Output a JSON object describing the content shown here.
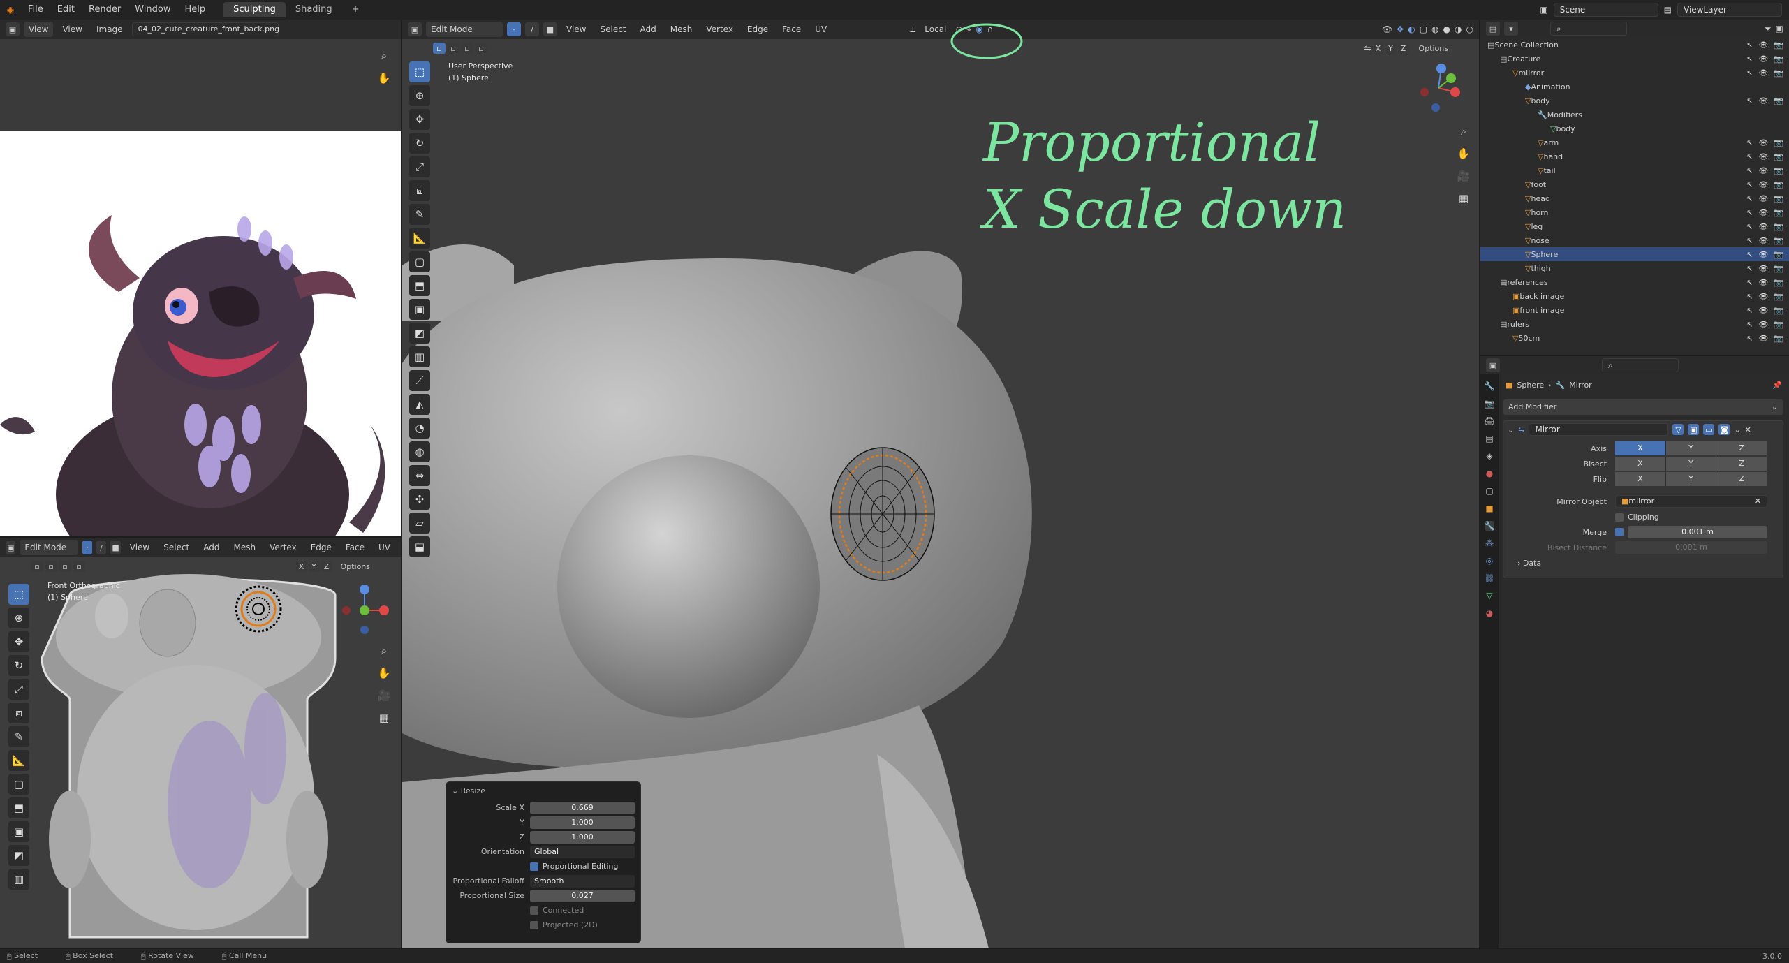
{
  "topbar": {
    "menus": [
      "File",
      "Edit",
      "Render",
      "Window",
      "Help"
    ],
    "workspaces": [
      "Sculpting",
      "Shading"
    ],
    "add_tab": "+",
    "scene_label": "Scene",
    "viewlayer_label": "ViewLayer"
  },
  "image_editor": {
    "menu": [
      "View",
      "View",
      "Image"
    ],
    "image_name": "04_02_cute_creature_front_back.png"
  },
  "small_viewport": {
    "mode": "Edit Mode",
    "menus": [
      "View",
      "Select",
      "Add",
      "Mesh",
      "Vertex",
      "Edge",
      "Face",
      "UV"
    ],
    "axes": [
      "X",
      "Y",
      "Z"
    ],
    "options": "Options",
    "view_name": "Front Orthographic",
    "object_name": "(1) Sphere"
  },
  "main_viewport": {
    "mode": "Edit Mode",
    "menus": [
      "View",
      "Select",
      "Add",
      "Mesh",
      "Vertex",
      "Edge",
      "Face",
      "UV"
    ],
    "orientation": "Local",
    "axes": [
      "X",
      "Y",
      "Z"
    ],
    "options": "Options",
    "view_name": "User Perspective",
    "object_name": "(1) Sphere",
    "handwriting_line1": "Proportional",
    "handwriting_line2": "X Scale down"
  },
  "resize_panel": {
    "title": "Resize",
    "scale_x_label": "Scale X",
    "scale_x": "0.669",
    "y_label": "Y",
    "y": "1.000",
    "z_label": "Z",
    "z": "1.000",
    "orientation_label": "Orientation",
    "orientation": "Global",
    "proportional_editing": "Proportional Editing",
    "falloff_label": "Proportional Falloff",
    "falloff": "Smooth",
    "size_label": "Proportional Size",
    "size": "0.027",
    "connected": "Connected",
    "projected": "Projected (2D)"
  },
  "outliner": {
    "header": "Scene Collection",
    "rows": [
      {
        "label": "Scene Collection",
        "indent": 0,
        "type": "collection"
      },
      {
        "label": "Creature",
        "indent": 1,
        "type": "collection"
      },
      {
        "label": "miirror",
        "indent": 2,
        "type": "object"
      },
      {
        "label": "Animation",
        "indent": 3,
        "type": "anim"
      },
      {
        "label": "body",
        "indent": 3,
        "type": "object"
      },
      {
        "label": "Modifiers",
        "indent": 4,
        "type": "mod"
      },
      {
        "label": "body",
        "indent": 5,
        "type": "mesh"
      },
      {
        "label": "arm",
        "indent": 4,
        "type": "object"
      },
      {
        "label": "hand",
        "indent": 4,
        "type": "object"
      },
      {
        "label": "tail",
        "indent": 4,
        "type": "object"
      },
      {
        "label": "foot",
        "indent": 3,
        "type": "object"
      },
      {
        "label": "head",
        "indent": 3,
        "type": "object"
      },
      {
        "label": "horn",
        "indent": 3,
        "type": "object"
      },
      {
        "label": "leg",
        "indent": 3,
        "type": "object"
      },
      {
        "label": "nose",
        "indent": 3,
        "type": "object"
      },
      {
        "label": "Sphere",
        "indent": 3,
        "type": "object",
        "selected": true
      },
      {
        "label": "thigh",
        "indent": 3,
        "type": "object"
      },
      {
        "label": "references",
        "indent": 1,
        "type": "collection"
      },
      {
        "label": "back image",
        "indent": 2,
        "type": "image"
      },
      {
        "label": "front image",
        "indent": 2,
        "type": "image"
      },
      {
        "label": "rulers",
        "indent": 1,
        "type": "collection"
      },
      {
        "label": "50cm",
        "indent": 2,
        "type": "object"
      }
    ]
  },
  "properties": {
    "breadcrumb_object": "Sphere",
    "breadcrumb_modifier": "Mirror",
    "add_modifier": "Add Modifier",
    "modifier_name": "Mirror",
    "axis_label": "Axis",
    "bisect_label": "Bisect",
    "flip_label": "Flip",
    "x": "X",
    "y": "Y",
    "z": "Z",
    "mirror_object_label": "Mirror Object",
    "mirror_object": "miirror",
    "clipping": "Clipping",
    "merge_label": "Merge",
    "merge_value": "0.001 m",
    "bisect_distance_label": "Bisect Distance",
    "bisect_distance": "0.001 m",
    "data": "Data"
  },
  "statusbar": {
    "items": [
      "Select",
      "Box Select",
      "Rotate View",
      "Call Menu"
    ],
    "version": "3.0.0"
  }
}
